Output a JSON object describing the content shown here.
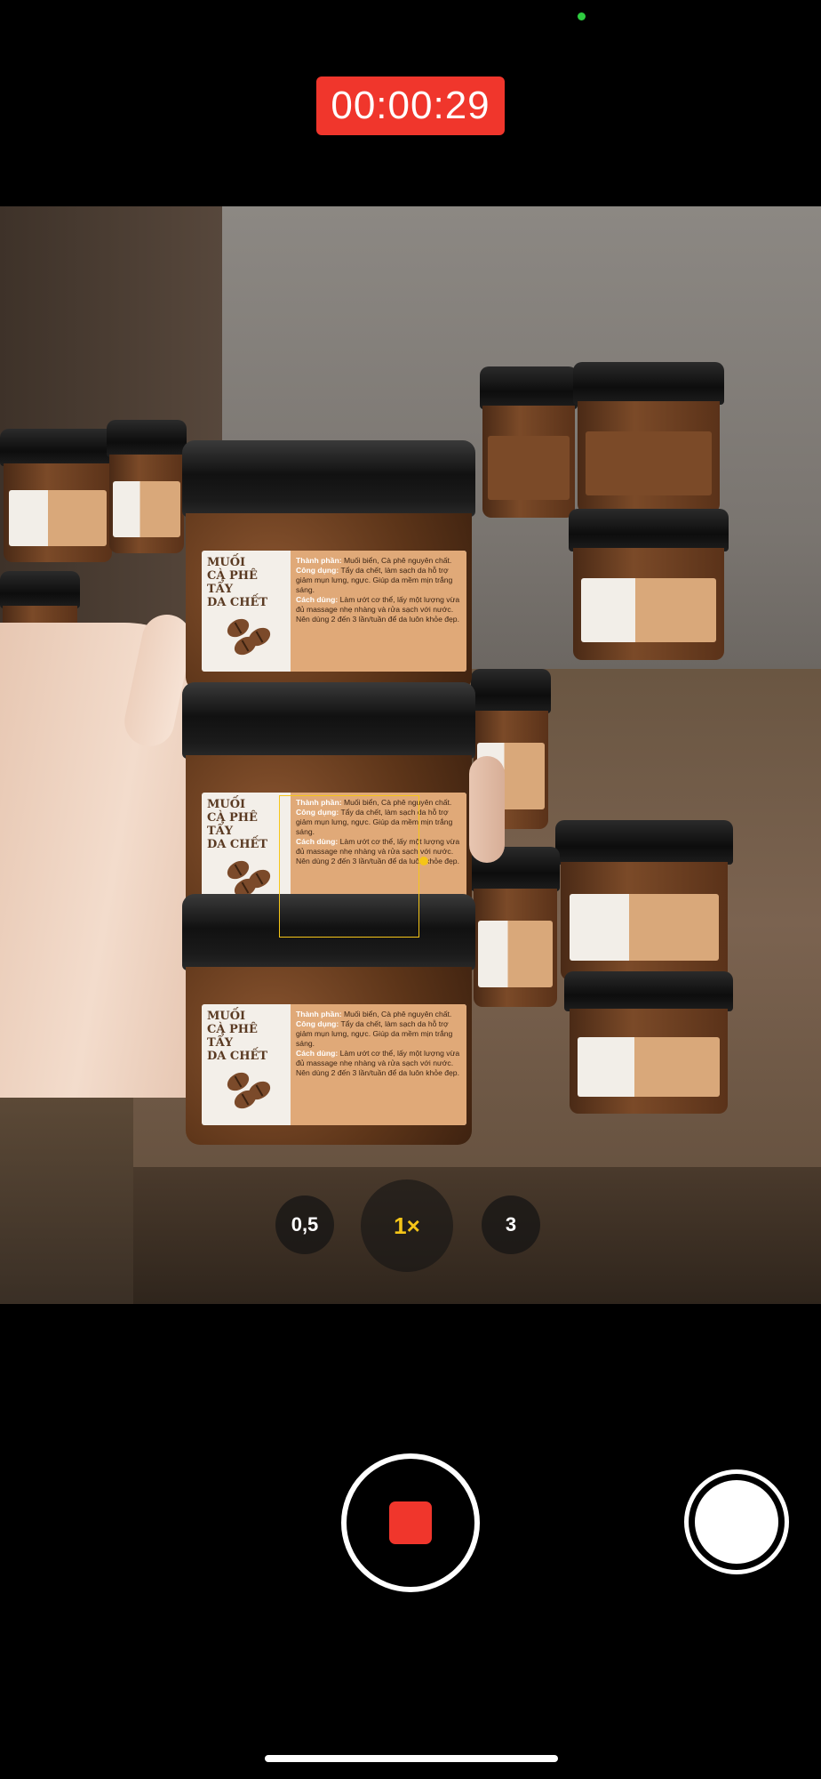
{
  "recording": {
    "timer": "00:00:29",
    "accent_color": "#f0362c"
  },
  "product_label": {
    "title_line1": "MUỐI",
    "title_line2": "CÀ PHÊ TẨY",
    "title_line3": "DA CHẾT",
    "ingredients_heading": "Thành phần:",
    "ingredients_text": "Muối biển, Cà phê nguyên chất.",
    "uses_heading": "Công dụng:",
    "uses_text": "Tẩy da chết, làm sạch da hỗ trợ giảm mụn lưng, ngực. Giúp da mềm mịn trắng sáng.",
    "directions_heading": "Cách dùng:",
    "directions_text": "Làm ướt cơ thể, lấy một lượng vừa đủ massage nhẹ nhàng và rửa sạch với nước. Nên dùng 2 đến 3 lần/tuần để da luôn khỏe đẹp."
  },
  "zoom": {
    "options": [
      "0,5",
      "1×",
      "3"
    ],
    "active_index": 1,
    "active_color": "#f5c518"
  },
  "controls": {
    "shutter_icon": "stop-recording-icon",
    "photo_icon": "capture-photo-icon"
  }
}
